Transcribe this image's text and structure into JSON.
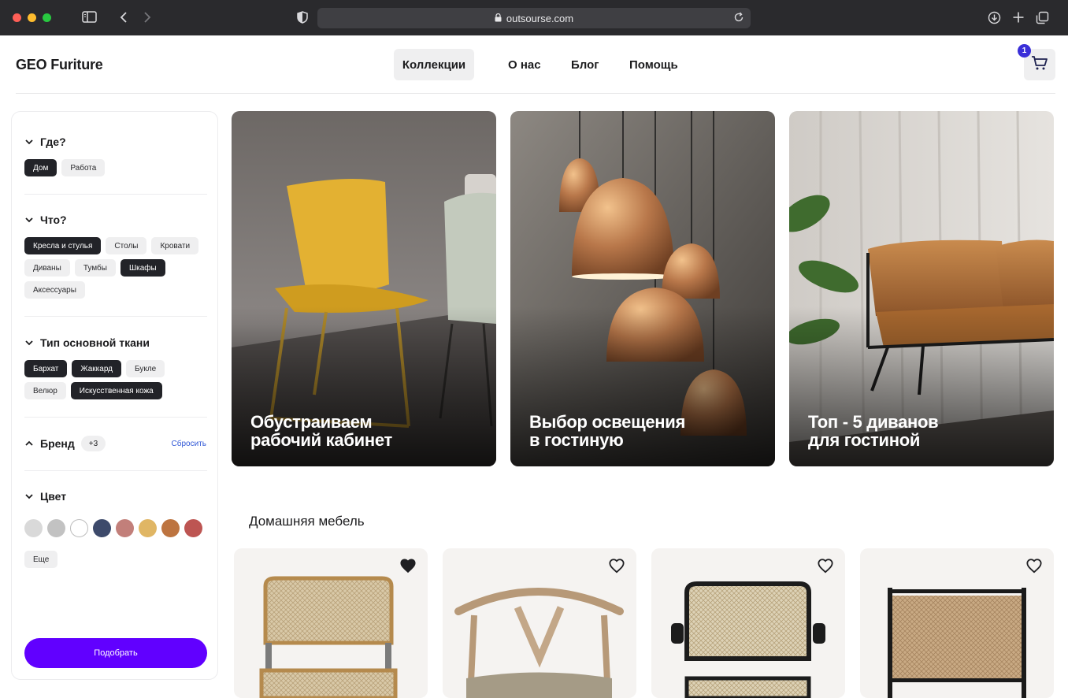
{
  "browser": {
    "url": "outsourse.com"
  },
  "header": {
    "logo": "GEO Furiture",
    "nav": [
      "Коллекции",
      "О нас",
      "Блог",
      "Помощь"
    ],
    "cart_count": "1"
  },
  "filters": {
    "where": {
      "title": "Где?",
      "options": [
        "Дом",
        "Работа"
      ]
    },
    "what": {
      "title": "Что?",
      "options": [
        "Кресла и стулья",
        "Столы",
        "Кровати",
        "Диваны",
        "Тумбы",
        "Шкафы",
        "Аксессуары"
      ]
    },
    "fabric": {
      "title": "Тип основной ткани",
      "options": [
        "Бархат",
        "Жаккард",
        "Букле",
        "Велюр",
        "Искусственная кожа"
      ]
    },
    "brand": {
      "title": "Бренд",
      "count": "+3",
      "reset": "Сбросить"
    },
    "color": {
      "title": "Цвет",
      "swatches": [
        "#d9d9d9",
        "#c2c2c2",
        "#ffffff",
        "#3d4a6b",
        "#c27f7a",
        "#e0b664",
        "#bd7440",
        "#bd5552"
      ],
      "more": "Еще"
    },
    "submit": "Подобрать"
  },
  "collections": [
    {
      "caption": "Обустраиваем\nрабочий кабинет"
    },
    {
      "caption": "Выбор освещения\nв гостиную"
    },
    {
      "caption": "Топ - 5 диванов\nдля гостиной"
    }
  ],
  "products_section": {
    "title": "Домашняя мебель"
  }
}
